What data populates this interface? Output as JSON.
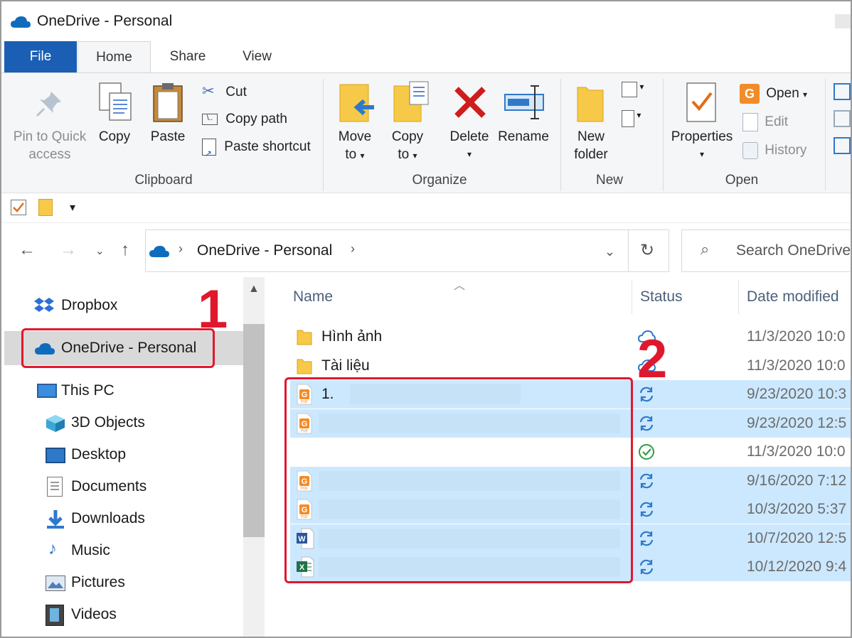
{
  "window": {
    "title": "OneDrive - Personal"
  },
  "ribbon_tabs": [
    {
      "label": "File"
    },
    {
      "label": "Home"
    },
    {
      "label": "Share"
    },
    {
      "label": "View"
    }
  ],
  "ribbon": {
    "clipboard": {
      "group_label": "Clipboard",
      "pin_label_1": "Pin to Quick",
      "pin_label_2": "access",
      "copy_label": "Copy",
      "paste_label": "Paste",
      "cut_label": "Cut",
      "copy_path_label": "Copy path",
      "paste_shortcut_label": "Paste shortcut"
    },
    "organize": {
      "group_label": "Organize",
      "move_label_1": "Move",
      "move_label_2": "to",
      "copy_label_1": "Copy",
      "copy_label_2": "to",
      "delete_label": "Delete",
      "rename_label": "Rename"
    },
    "new": {
      "group_label": "New",
      "folder_label_1": "New",
      "folder_label_2": "folder"
    },
    "open": {
      "group_label": "Open",
      "properties_label": "Properties",
      "open_label": "Open",
      "edit_label": "Edit",
      "history_label": "History"
    }
  },
  "address": {
    "path": "OneDrive - Personal",
    "search_placeholder": "Search OneDrive"
  },
  "nav": {
    "items": [
      {
        "label": "Dropbox",
        "icon": "dropbox-icon"
      },
      {
        "label": "OneDrive - Personal",
        "icon": "onedrive-cloud-icon",
        "selected": true
      },
      {
        "label": "This PC",
        "icon": "pc-icon"
      },
      {
        "label": "3D Objects",
        "icon": "cube-icon"
      },
      {
        "label": "Desktop",
        "icon": "desktop-icon"
      },
      {
        "label": "Documents",
        "icon": "documents-icon"
      },
      {
        "label": "Downloads",
        "icon": "downloads-icon"
      },
      {
        "label": "Music",
        "icon": "music-icon"
      },
      {
        "label": "Pictures",
        "icon": "pictures-icon"
      },
      {
        "label": "Videos",
        "icon": "videos-icon"
      }
    ]
  },
  "file_list": {
    "columns": {
      "name": "Name",
      "status": "Status",
      "date": "Date modified"
    },
    "rows": [
      {
        "name": "Hình ảnh",
        "type": "folder",
        "status": "cloud",
        "date": "11/3/2020 10:0",
        "selected": false
      },
      {
        "name": "Tài liệu",
        "type": "folder",
        "status": "cloud",
        "date": "11/3/2020 10:0",
        "selected": false
      },
      {
        "name": "1.",
        "type": "pdf",
        "status": "sync",
        "date": "9/23/2020 10:3",
        "selected": true
      },
      {
        "name": "",
        "type": "pdf",
        "status": "sync",
        "date": "9/23/2020 12:5",
        "selected": true
      },
      {
        "name": "",
        "type": "none",
        "status": "ok",
        "date": "11/3/2020 10:0",
        "selected": false
      },
      {
        "name": "",
        "type": "pdf",
        "status": "sync",
        "date": "9/16/2020 7:12",
        "selected": true
      },
      {
        "name": "",
        "type": "pdf",
        "status": "sync",
        "date": "10/3/2020 5:37",
        "selected": true
      },
      {
        "name": "",
        "type": "word",
        "status": "sync",
        "date": "10/7/2020 12:5",
        "selected": true
      },
      {
        "name": "",
        "type": "excel",
        "status": "sync",
        "date": "10/12/2020 9:4",
        "selected": true
      }
    ]
  },
  "annotations": {
    "marker_1": "1",
    "marker_2": "2"
  },
  "colors": {
    "accent": "#1a5fb4",
    "selection": "#cce8ff",
    "annotation": "#e0182d",
    "onedrive": "#0f6cbd"
  }
}
